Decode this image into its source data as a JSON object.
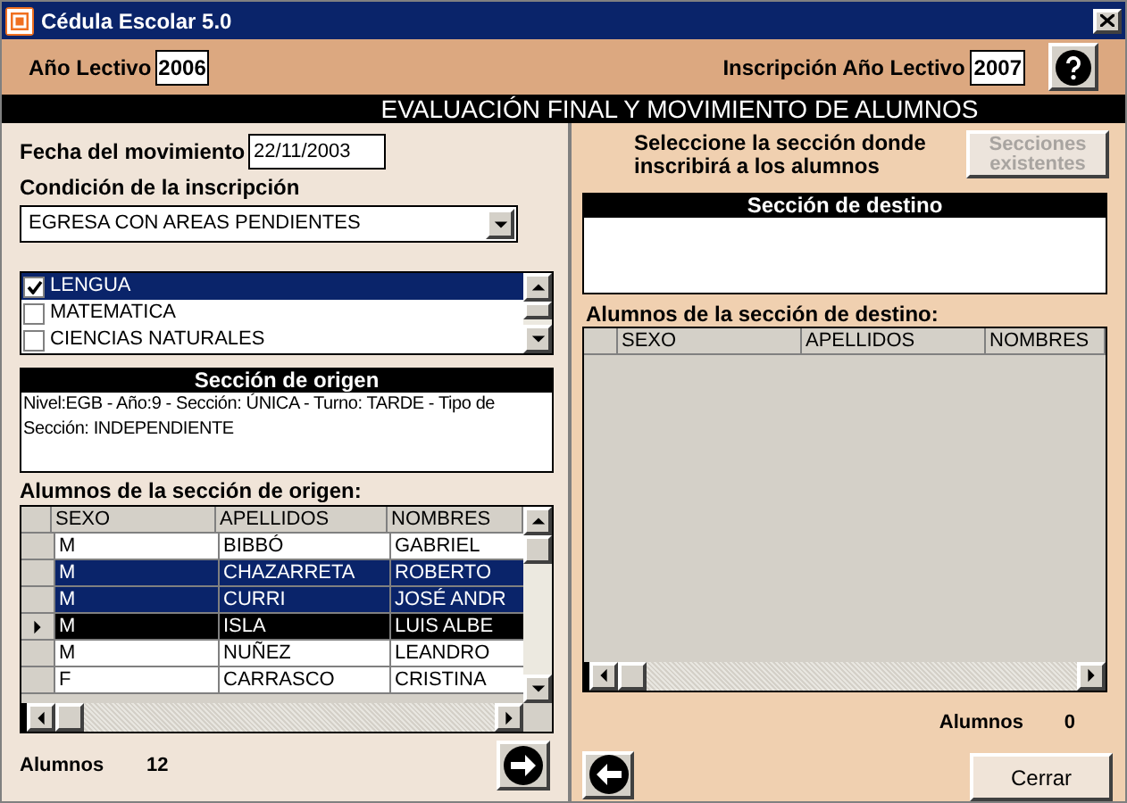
{
  "window": {
    "title": "Cédula Escolar 5.0"
  },
  "header": {
    "year_label": "Año Lectivo",
    "year": "2006",
    "enroll_label": "Inscripción Año Lectivo",
    "enroll_year": "2007"
  },
  "banner": "EVALUACIÓN FINAL Y MOVIMIENTO DE ALUMNOS",
  "left": {
    "date_label": "Fecha del movimiento",
    "date": "22/11/2003",
    "condition_label": "Condición de la inscripción",
    "condition": "EGRESA CON AREAS PENDIENTES",
    "areas": [
      {
        "label": "LENGUA",
        "checked": true,
        "selected": true
      },
      {
        "label": "MATEMATICA",
        "checked": false,
        "selected": false
      },
      {
        "label": "CIENCIAS NATURALES",
        "checked": false,
        "selected": false
      }
    ],
    "origin_title": "Sección de origen",
    "origin_text": "Nivel:EGB - Año:9 - Sección: ÚNICA - Turno: TARDE - Tipo de Sección: INDEPENDIENTE",
    "grid_label": "Alumnos de la sección de origen:",
    "columns": [
      "SEXO",
      "APELLIDOS",
      "NOMBRES"
    ],
    "rows": [
      {
        "cells": [
          "M",
          "BIBBÓ",
          "GABRIEL"
        ],
        "selected": false,
        "current": false
      },
      {
        "cells": [
          "M",
          "CHAZARRETA",
          "ROBERTO"
        ],
        "selected": true,
        "current": false
      },
      {
        "cells": [
          "M",
          "CURRI",
          "JOSÉ ANDR"
        ],
        "selected": true,
        "current": false
      },
      {
        "cells": [
          "M",
          "ISLA",
          "LUIS ALBE"
        ],
        "selected": true,
        "current": true
      },
      {
        "cells": [
          "M",
          "NUÑEZ",
          "LEANDRO"
        ],
        "selected": false,
        "current": false
      },
      {
        "cells": [
          "F",
          "CARRASCO",
          "CRISTINA"
        ],
        "selected": false,
        "current": false
      }
    ],
    "count_label": "Alumnos",
    "count": "12"
  },
  "right": {
    "prompt": "Seleccione la sección donde inscribirá a los alumnos",
    "sections_button": {
      "label": "Secciones existentes",
      "disabled": true
    },
    "dest_title": "Sección de destino",
    "grid_label": "Alumnos de la sección de destino:",
    "columns": [
      "SEXO",
      "APELLIDOS",
      "NOMBRES"
    ],
    "count_label": "Alumnos",
    "count": "0",
    "close_button": "Cerrar"
  }
}
